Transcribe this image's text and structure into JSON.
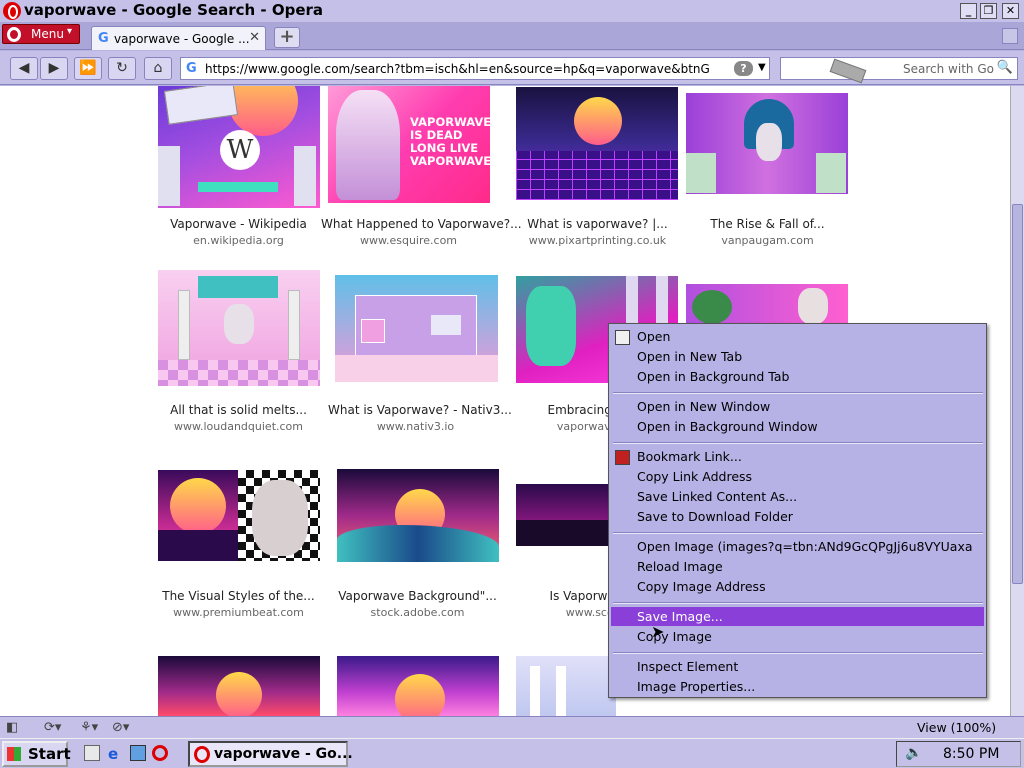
{
  "window": {
    "title": "vaporwave - Google Search - Opera"
  },
  "tabbar": {
    "menu_label": "Menu",
    "tab_label": "vaporwave - Google ...",
    "tab_close": "✕",
    "new_tab": "+"
  },
  "nav": {
    "url": "https://www.google.com/search?tbm=isch&hl=en&source=hp&q=vaporwave&btnG=Search+",
    "help": "?",
    "search_placeholder": "Search with Go"
  },
  "results": [
    {
      "title": "Vaporwave - Wikipedia",
      "site": "en.wikipedia.org"
    },
    {
      "title": "What Happened to Vaporwave?...",
      "site": "www.esquire.com"
    },
    {
      "title": "What is vaporwave? |...",
      "site": "www.pixartprinting.co.uk"
    },
    {
      "title": "The Rise & Fall of...",
      "site": "vanpaugam.com"
    },
    {
      "title": "All that is solid melts...",
      "site": "www.loudandquiet.com"
    },
    {
      "title": "What is Vaporwave? - Nativ3...",
      "site": "www.nativ3.io"
    },
    {
      "title": "Embracing the C",
      "site": "vaporwavebou"
    },
    {
      "title": "",
      "site": ""
    },
    {
      "title": "The Visual Styles of the...",
      "site": "www.premiumbeat.com"
    },
    {
      "title": "Vaporwave Background\"...",
      "site": "stock.adobe.com"
    },
    {
      "title": "Is Vaporwave th",
      "site": "www.scottfl"
    }
  ],
  "image_text": {
    "esquire": "VAPORWAVE\nIS DEAD\nLONG LIVE\nVAPORWAVE",
    "wiki": "W"
  },
  "context_menu": {
    "items": [
      "Open",
      "Open in New Tab",
      "Open in Background Tab",
      "Open in New Window",
      "Open in Background Window",
      "Bookmark Link...",
      "Copy Link Address",
      "Save Linked Content As...",
      "Save to Download Folder",
      "Open Image (images?q=tbn:ANd9GcQPgJj6u8VYUaxa",
      "Reload Image",
      "Copy Image Address",
      "Save Image...",
      "Copy Image",
      "Inspect Element",
      "Image Properties..."
    ],
    "highlighted": "Save Image..."
  },
  "statusbar": {
    "zoom": "View (100%)"
  },
  "taskbar": {
    "start": "Start",
    "task": "vaporwave - Go...",
    "clock": "8:50 PM"
  },
  "colors": {
    "chrome": "#c4c0e8",
    "menu_highlight": "#8a3fd8",
    "opera_red": "#c2102a"
  }
}
